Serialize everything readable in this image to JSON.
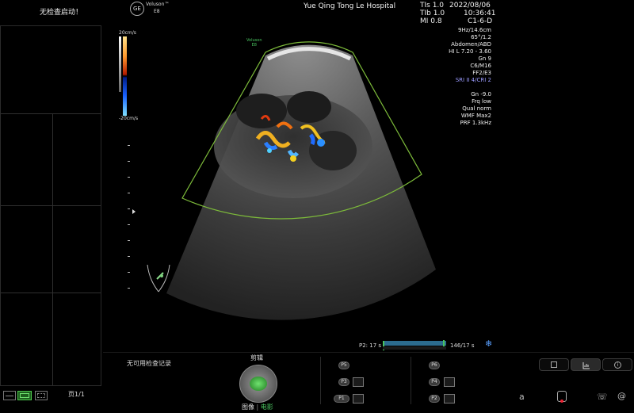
{
  "left_panel": {
    "no_exam_started": "无检查启动！",
    "page_indicator": "页1/1"
  },
  "header": {
    "brand": "Voluson",
    "brand_tm": "™",
    "brand_sub": "E8",
    "hospital": "Yue Qing  Tong Le Hospital",
    "tis": "TIs  1.0",
    "tib": "TIb  1.0",
    "mi": "MI  0.8",
    "date": "2022/08/06",
    "time": "10:36:41",
    "probe": "C1-6-D"
  },
  "scale": {
    "top": "20cm/s",
    "bottom": "-20cm/s"
  },
  "imaging_params": [
    "9Hz/14.6cm",
    "65°/1.2",
    "Abdomen/ABD",
    "HI L  7.20 - 3.60",
    "Gn  9",
    "C6/M16",
    "FF2/E3"
  ],
  "sri_param": "SRI II 4/CRI 2",
  "color_params": [
    "Gn -9.0",
    "Frq low",
    "Qual norm",
    "WMF Max2",
    "PRF 1.3kHz"
  ],
  "image_logo": {
    "line1": "Voluson",
    "line2": "E8"
  },
  "cine": {
    "left_label": "P2:  17 s",
    "right_label": "146/17 s"
  },
  "bottom": {
    "no_records": "无可用检查记录",
    "trackball_title": "剪辑",
    "trackball_image": "图像",
    "trackball_sep": "|",
    "trackball_cine": "电影",
    "buttons": {
      "p5": "P5",
      "p3": "P3",
      "p1": "P1",
      "p6": "P6",
      "p4": "P4",
      "p2": "P2"
    },
    "right_a": "a",
    "right_at": "@"
  },
  "colors": {
    "sector_outline": "#7dbb3a",
    "sri": "#9b9bff",
    "cine_green": "#49c35f"
  }
}
